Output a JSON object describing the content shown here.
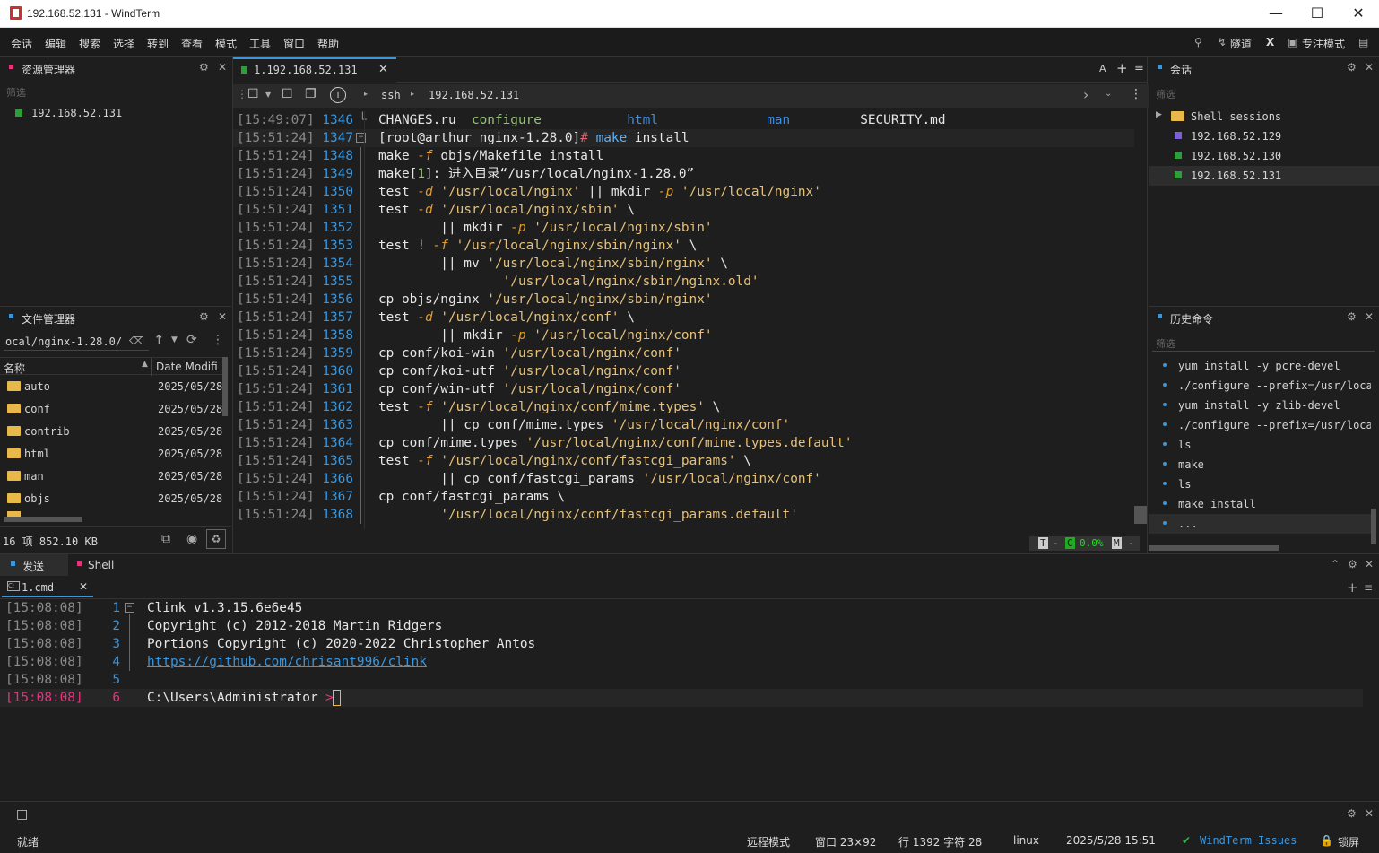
{
  "window": {
    "title": "192.168.52.131 - WindTerm"
  },
  "menu": [
    "会话",
    "编辑",
    "搜索",
    "选择",
    "转到",
    "查看",
    "模式",
    "工具",
    "窗口",
    "帮助"
  ],
  "menu_right": {
    "tunnel": "隧道",
    "x": "X",
    "focus_mode": "专注模式"
  },
  "resource_manager": {
    "title": "资源管理器",
    "filter_placeholder": "筛选",
    "items": [
      "192.168.52.131"
    ]
  },
  "file_manager": {
    "title": "文件管理器",
    "path": "ocal/nginx-1.28.0/",
    "col_name": "名称",
    "col_date": "Date Modifi",
    "rows": [
      {
        "name": "auto",
        "date": "2025/05/28"
      },
      {
        "name": "conf",
        "date": "2025/05/28"
      },
      {
        "name": "contrib",
        "date": "2025/05/28"
      },
      {
        "name": "html",
        "date": "2025/05/28"
      },
      {
        "name": "man",
        "date": "2025/05/28"
      },
      {
        "name": "objs",
        "date": "2025/05/28"
      }
    ],
    "summary": "16 项 852.10 KB"
  },
  "terminal": {
    "tab_label": "1.192.168.52.131",
    "tab_font_btn": "A",
    "breadcrumb": [
      "ssh",
      "192.168.52.131"
    ],
    "lines": [
      {
        "ts": "[15:49:07]",
        "n": "1346",
        "html": "CHANGES.ru  <span class=\"s-grn\">configure</span>           <span class=\"s-dir\">html</span>              <span class=\"s-dir\">man</span>         SECURITY.md"
      },
      {
        "ts": "[15:51:24]",
        "n": "1347",
        "html": "[root@arthur nginx-1.28.0]<span class=\"s-hash\">#</span> <span class=\"s-cmd\">make</span> install"
      },
      {
        "ts": "[15:51:24]",
        "n": "1348",
        "html": "make <span class=\"s-flag\">-f</span> objs/Makefile install"
      },
      {
        "ts": "[15:51:24]",
        "n": "1349",
        "html": "make[<span class=\"s-grn\">1</span>]: 进入目录“/usr/local/nginx-1.28.0”"
      },
      {
        "ts": "[15:51:24]",
        "n": "1350",
        "html": "test <span class=\"s-flag\">-d</span> <span class=\"s-str\">'/usr/local/nginx'</span> || mkdir <span class=\"s-flag\">-p</span> <span class=\"s-str\">'/usr/local/nginx'</span>"
      },
      {
        "ts": "[15:51:24]",
        "n": "1351",
        "html": "test <span class=\"s-flag\">-d</span> <span class=\"s-str\">'/usr/local/nginx/sbin'</span> \\"
      },
      {
        "ts": "[15:51:24]",
        "n": "1352",
        "html": "        || mkdir <span class=\"s-flag\">-p</span> <span class=\"s-str\">'/usr/local/nginx/sbin'</span>"
      },
      {
        "ts": "[15:51:24]",
        "n": "1353",
        "html": "test ! <span class=\"s-flag\">-f</span> <span class=\"s-str\">'/usr/local/nginx/sbin/nginx'</span> \\"
      },
      {
        "ts": "[15:51:24]",
        "n": "1354",
        "html": "        || mv <span class=\"s-str\">'/usr/local/nginx/sbin/nginx'</span> \\"
      },
      {
        "ts": "[15:51:24]",
        "n": "1355",
        "html": "                <span class=\"s-str\">'/usr/local/nginx/sbin/nginx.old'</span>"
      },
      {
        "ts": "[15:51:24]",
        "n": "1356",
        "html": "cp objs/nginx <span class=\"s-str\">'/usr/local/nginx/sbin/nginx'</span>"
      },
      {
        "ts": "[15:51:24]",
        "n": "1357",
        "html": "test <span class=\"s-flag\">-d</span> <span class=\"s-str\">'/usr/local/nginx/conf'</span> \\"
      },
      {
        "ts": "[15:51:24]",
        "n": "1358",
        "html": "        || mkdir <span class=\"s-flag\">-p</span> <span class=\"s-str\">'/usr/local/nginx/conf'</span>"
      },
      {
        "ts": "[15:51:24]",
        "n": "1359",
        "html": "cp conf/koi-win <span class=\"s-str\">'/usr/local/nginx/conf'</span>"
      },
      {
        "ts": "[15:51:24]",
        "n": "1360",
        "html": "cp conf/koi-utf <span class=\"s-str\">'/usr/local/nginx/conf'</span>"
      },
      {
        "ts": "[15:51:24]",
        "n": "1361",
        "html": "cp conf/win-utf <span class=\"s-str\">'/usr/local/nginx/conf'</span>"
      },
      {
        "ts": "[15:51:24]",
        "n": "1362",
        "html": "test <span class=\"s-flag\">-f</span> <span class=\"s-str\">'/usr/local/nginx/conf/mime.types'</span> \\"
      },
      {
        "ts": "[15:51:24]",
        "n": "1363",
        "html": "        || cp conf/mime.types <span class=\"s-str\">'/usr/local/nginx/conf'</span>"
      },
      {
        "ts": "[15:51:24]",
        "n": "1364",
        "html": "cp conf/mime.types <span class=\"s-str\">'/usr/local/nginx/conf/mime.types.default'</span>"
      },
      {
        "ts": "[15:51:24]",
        "n": "1365",
        "html": "test <span class=\"s-flag\">-f</span> <span class=\"s-str\">'/usr/local/nginx/conf/fastcgi_params'</span> \\"
      },
      {
        "ts": "[15:51:24]",
        "n": "1366",
        "html": "        || cp conf/fastcgi_params <span class=\"s-str\">'/usr/local/nginx/conf'</span>"
      },
      {
        "ts": "[15:51:24]",
        "n": "1367",
        "html": "cp conf/fastcgi_params \\"
      },
      {
        "ts": "[15:51:24]",
        "n": "1368",
        "html": "        <span class=\"s-str\">'/usr/local/nginx/conf/fastcgi_params.default'</span>"
      }
    ],
    "status": {
      "t": "T",
      "dash1": "-",
      "c": "C",
      "pct": "0.0%",
      "m": "M",
      "dash2": "-"
    }
  },
  "sessions": {
    "title": "会话",
    "filter_placeholder": "筛选",
    "group": "Shell sessions",
    "items": [
      {
        "label": "192.168.52.129",
        "color": "#7b5fd6"
      },
      {
        "label": "192.168.52.130",
        "color": "#2e9e3a"
      },
      {
        "label": "192.168.52.131",
        "color": "#2e9e3a"
      }
    ]
  },
  "history": {
    "title": "历史命令",
    "filter_placeholder": "筛选",
    "items": [
      "yum install -y pcre-devel",
      "./configure --prefix=/usr/local",
      "yum install -y zlib-devel",
      "./configure --prefix=/usr/local",
      "ls",
      "make",
      "ls",
      "make install",
      "..."
    ]
  },
  "bottom": {
    "tab_send": "发送",
    "tab_shell": "Shell",
    "cmd_tab": "1.cmd",
    "lines": [
      {
        "ts": "[15:08:08]",
        "n": "1",
        "text": "Clink v1.3.15.6e6e45"
      },
      {
        "ts": "[15:08:08]",
        "n": "2",
        "text": "Copyright (c) 2012-2018 Martin Ridgers"
      },
      {
        "ts": "[15:08:08]",
        "n": "3",
        "text": "Portions Copyright (c) 2020-2022 Christopher Antos"
      },
      {
        "ts": "[15:08:08]",
        "n": "4",
        "text": "https://github.com/chrisant996/clink"
      },
      {
        "ts": "[15:08:08]",
        "n": "5",
        "text": ""
      },
      {
        "ts": "[15:08:08]",
        "n": "6",
        "text": "C:\\Users\\Administrator"
      }
    ],
    "prompt_char": ">"
  },
  "statusbar": {
    "ready": "就绪",
    "remote_mode": "远程模式",
    "window": "窗口 23×92",
    "position": "行 1392 字符 28",
    "os": "linux",
    "datetime": "2025/5/28 15:51",
    "issues": "WindTerm Issues",
    "lock": "锁屏"
  },
  "colors": {
    "accent": "#3a96dd",
    "folder": "#e8b84a",
    "pink": "#e5347e"
  }
}
